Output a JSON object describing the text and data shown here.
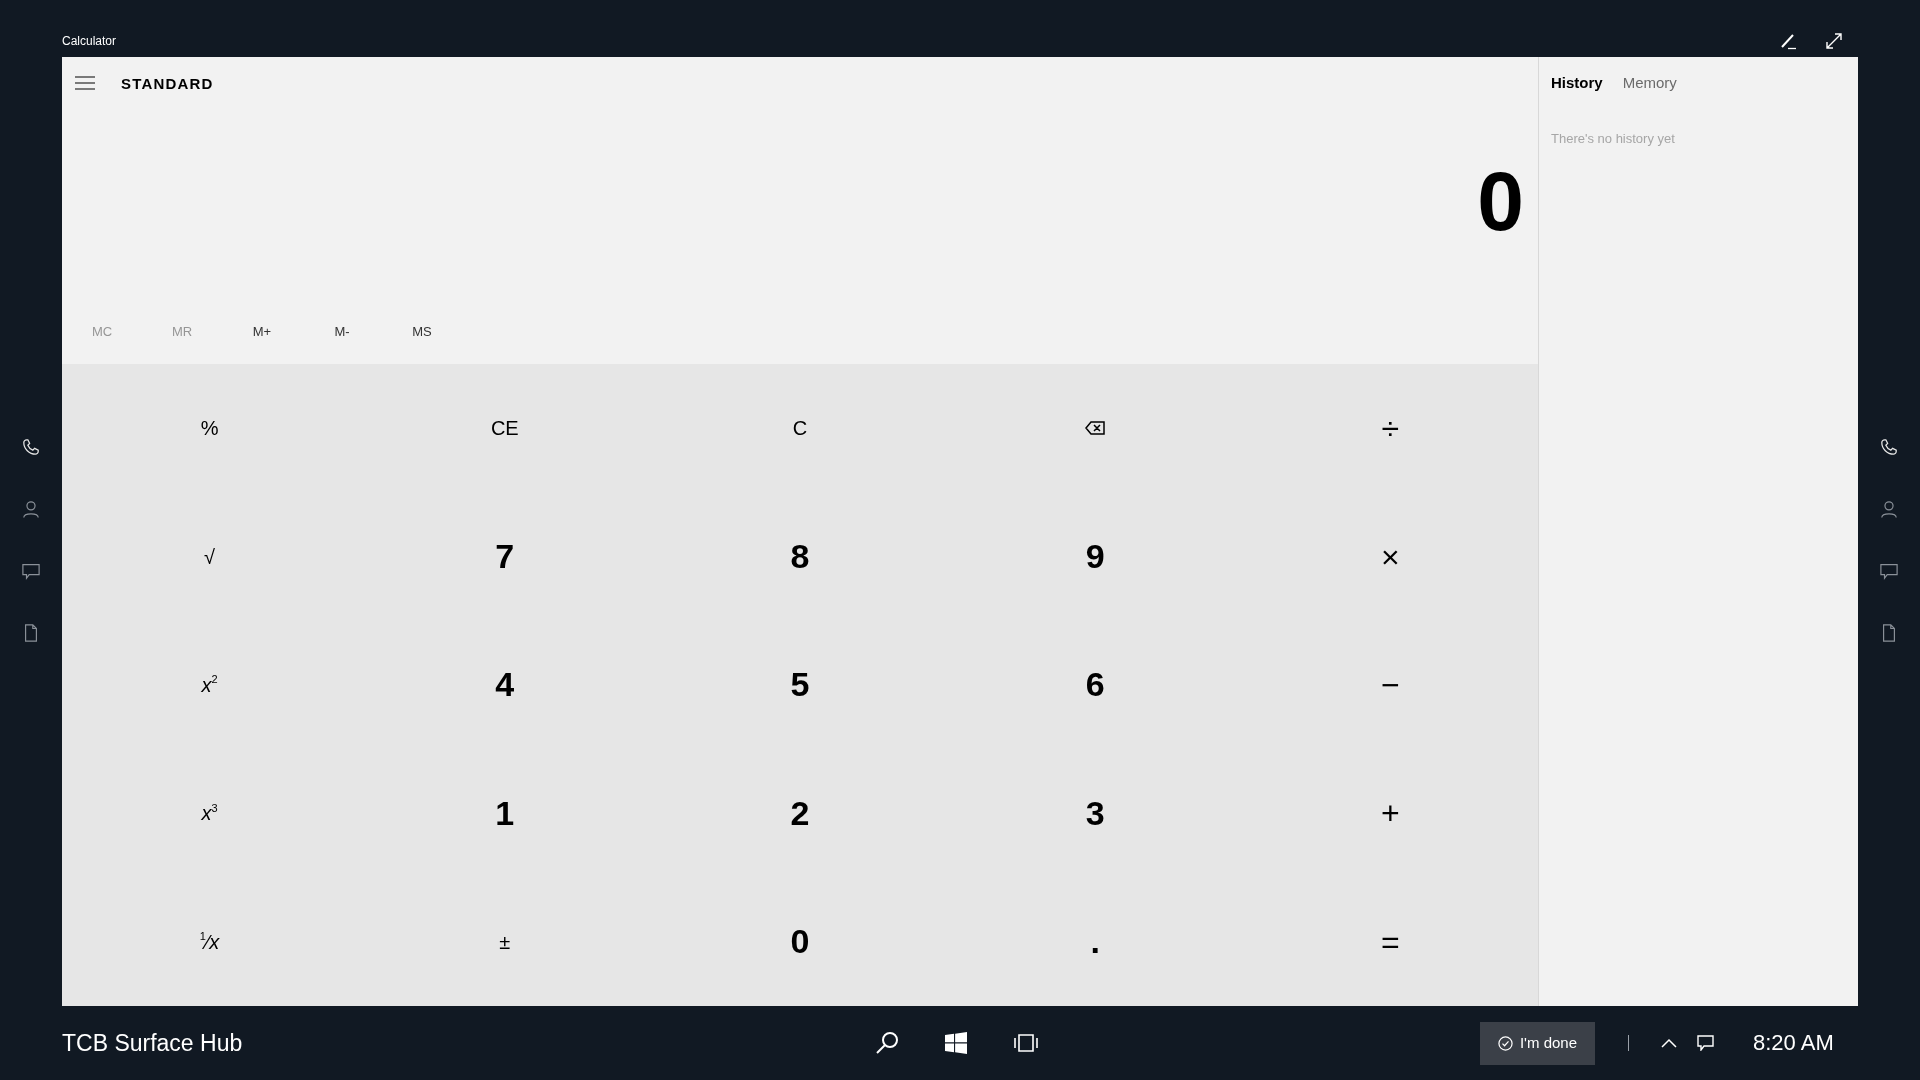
{
  "window": {
    "title": "Calculator"
  },
  "header": {
    "mode": "STANDARD"
  },
  "display": {
    "value": "0"
  },
  "memory_buttons": [
    {
      "label": "MC",
      "disabled": true
    },
    {
      "label": "MR",
      "disabled": true
    },
    {
      "label": "M+",
      "disabled": false
    },
    {
      "label": "M-",
      "disabled": false
    },
    {
      "label": "MS",
      "disabled": false
    }
  ],
  "keypad": [
    {
      "kind": "function",
      "label": "%"
    },
    {
      "kind": "function",
      "label": "CE"
    },
    {
      "kind": "function",
      "label": "C"
    },
    {
      "kind": "backspace"
    },
    {
      "kind": "operator",
      "label": "÷"
    },
    {
      "kind": "function",
      "label": "√"
    },
    {
      "kind": "digit",
      "label": "7"
    },
    {
      "kind": "digit",
      "label": "8"
    },
    {
      "kind": "digit",
      "label": "9"
    },
    {
      "kind": "operator",
      "label": "×"
    },
    {
      "kind": "function",
      "label": "*x*$^{2}$"
    },
    {
      "kind": "digit",
      "label": "4"
    },
    {
      "kind": "digit",
      "label": "5"
    },
    {
      "kind": "digit",
      "label": "6"
    },
    {
      "kind": "operator",
      "label": "−"
    },
    {
      "kind": "function",
      "label": "*x*$^{3}$"
    },
    {
      "kind": "digit",
      "label": "1"
    },
    {
      "kind": "digit",
      "label": "2"
    },
    {
      "kind": "digit",
      "label": "3"
    },
    {
      "kind": "operator",
      "label": "+"
    },
    {
      "kind": "function",
      "label": "$^{1}$⁄*x*"
    },
    {
      "kind": "function",
      "label": "±"
    },
    {
      "kind": "digit",
      "label": "0"
    },
    {
      "kind": "digit",
      "label": "."
    },
    {
      "kind": "operator",
      "label": "="
    }
  ],
  "history_panel": {
    "tabs": [
      {
        "label": "History",
        "selected": true
      },
      {
        "label": "Memory",
        "selected": false
      }
    ],
    "empty_message": "There's no history yet"
  },
  "taskbar": {
    "device_name": "TCB Surface Hub",
    "done_button": "I'm done",
    "time": "8:20 AM"
  }
}
